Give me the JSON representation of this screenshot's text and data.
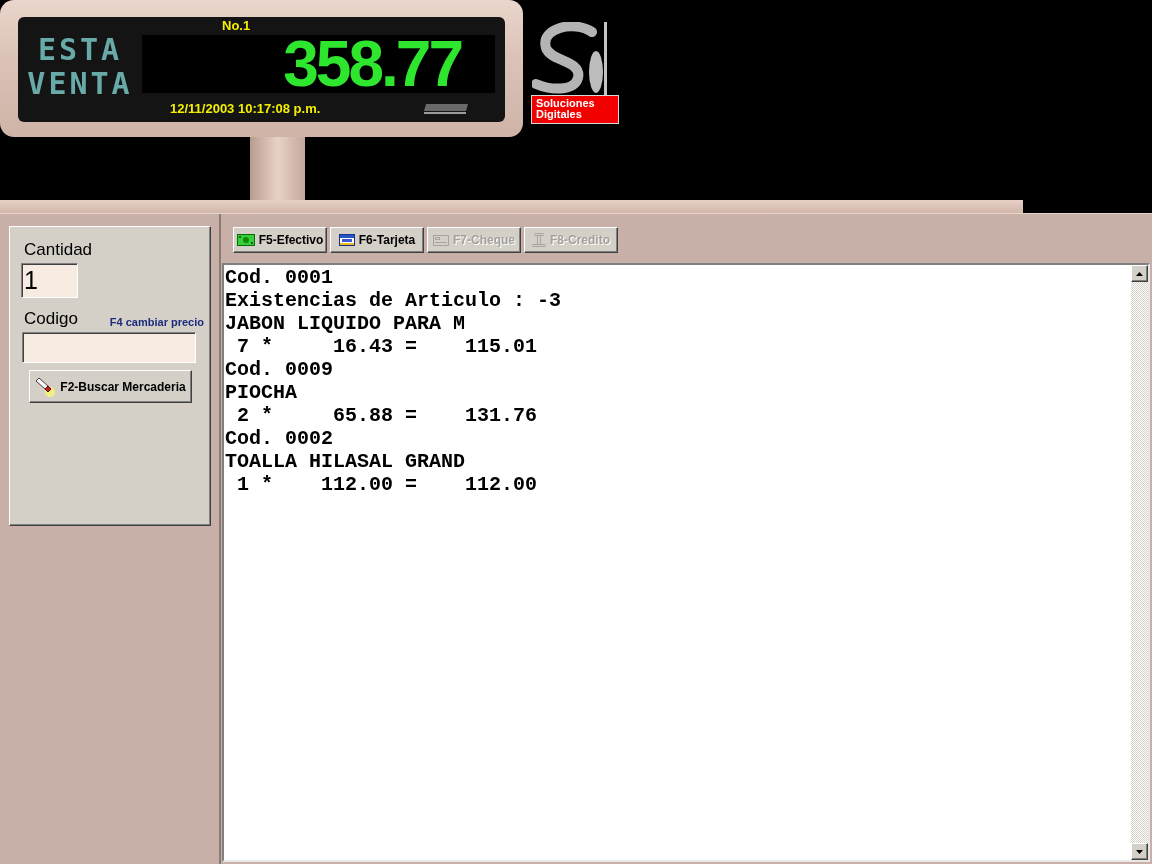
{
  "pole_display": {
    "register": "No.1",
    "label_lines": [
      "ESTA",
      "VENTA"
    ],
    "total": "358.77",
    "datetime": "12/11/2003 10:17:08 p.m."
  },
  "logo": {
    "caption_lines": [
      "Soluciones",
      "Digitales"
    ]
  },
  "entry_panel": {
    "quantity_label": "Cantidad",
    "quantity_value": "1",
    "code_label": "Codigo",
    "price_hint": "F4 cambiar precio",
    "search_button": "F2-Buscar Mercaderia"
  },
  "payment_buttons": [
    {
      "label": "F5-Efectivo",
      "kind": "cash",
      "disabled": false
    },
    {
      "label": "F6-Tarjeta",
      "kind": "card",
      "disabled": false
    },
    {
      "label": "F7-Cheque",
      "kind": "check",
      "disabled": true
    },
    {
      "label": "F8-Credito",
      "kind": "credit",
      "disabled": true
    }
  ],
  "receipt": {
    "lines": [
      "Cod. 0001",
      "Existencias de Articulo : -3",
      "JABON LIQUIDO PARA M",
      " 7 *     16.43 =    115.01",
      "Cod. 0009",
      "PIOCHA",
      " 2 *     65.88 =    131.76",
      "Cod. 0002",
      "TOALLA HILASAL GRAND",
      " 1 *    112.00 =    112.00"
    ]
  }
}
